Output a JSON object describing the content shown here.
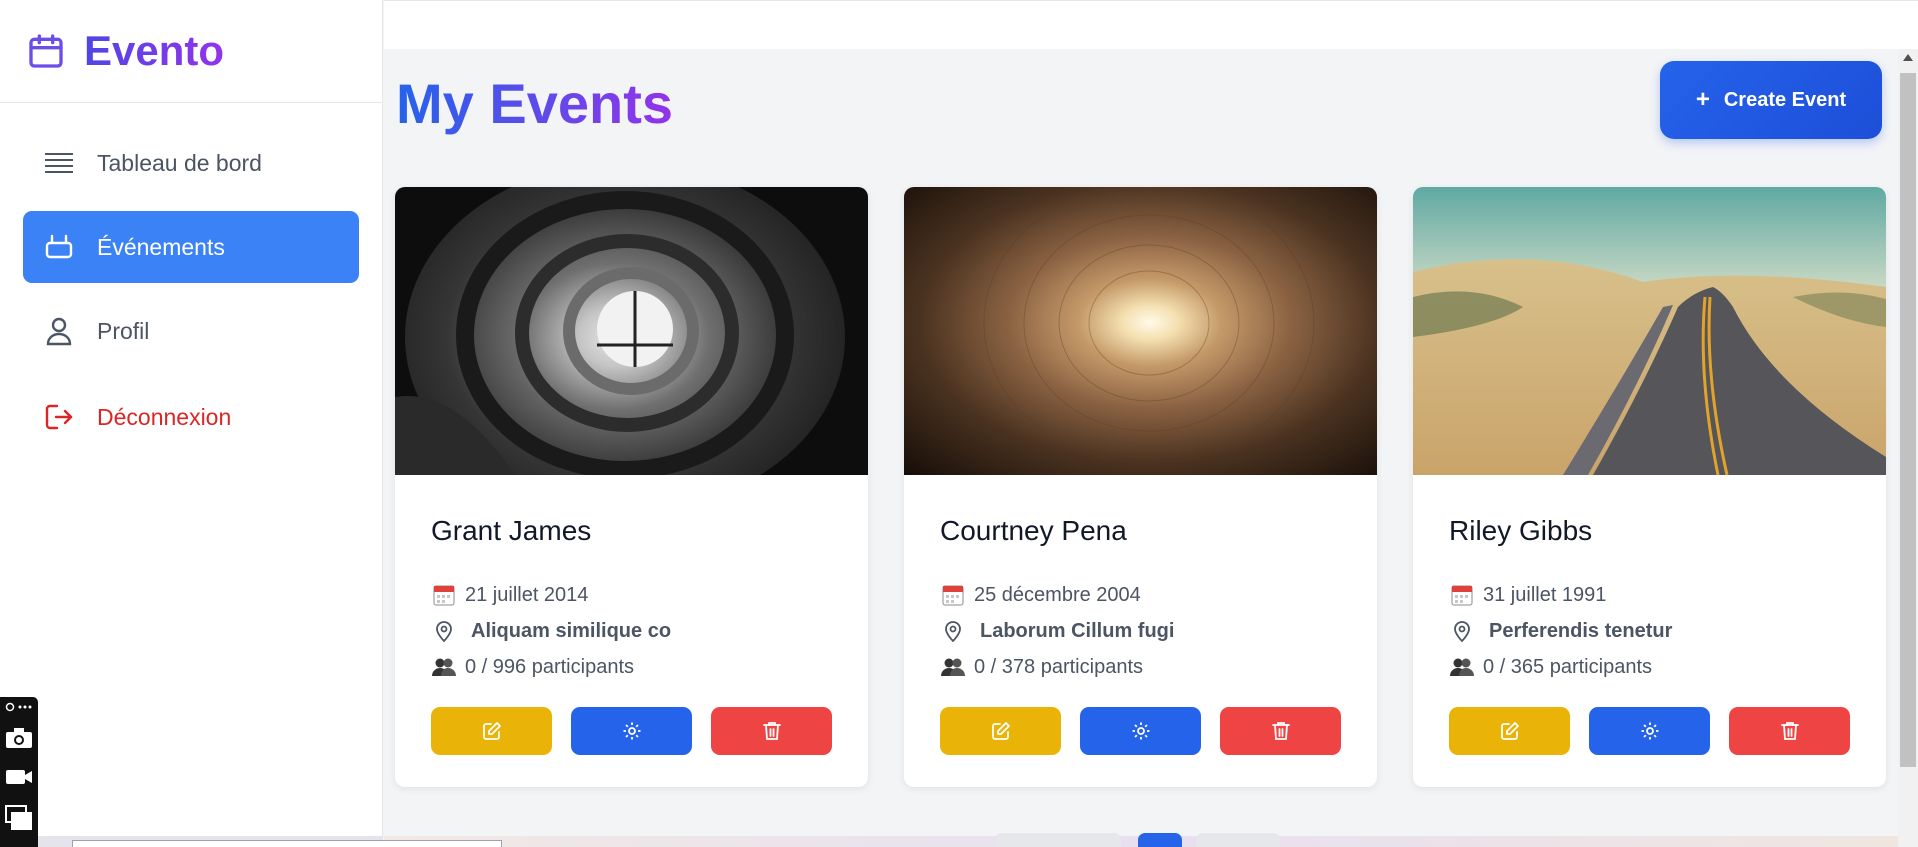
{
  "brand": {
    "name": "Evento",
    "icon": "calendar-icon",
    "color": "#6d4de8"
  },
  "sidebar": {
    "items": [
      {
        "label": "Tableau de bord",
        "icon": "menu-lines-icon",
        "active": false
      },
      {
        "label": "Événements",
        "icon": "event-icon",
        "active": true
      },
      {
        "label": "Profil",
        "icon": "user-icon",
        "active": false
      },
      {
        "label": "Déconnexion",
        "icon": "logout-icon",
        "active": false
      }
    ]
  },
  "main": {
    "title": "My Events",
    "create_button": {
      "icon": "+",
      "label": "Create Event"
    }
  },
  "events": [
    {
      "name": "Grant James",
      "date": "21 juillet 2014",
      "location": "Aliquam similique co",
      "participants": "0 / 996 participants",
      "image": "spiral-staircase"
    },
    {
      "name": "Courtney Pena",
      "date": "25 décembre 2004",
      "location": "Laborum Cillum fugi",
      "participants": "0 / 378 participants",
      "image": "tunnel-light"
    },
    {
      "name": "Riley Gibbs",
      "date": "31 juillet 1991",
      "location": "Perferendis tenetur",
      "participants": "0 / 365 participants",
      "image": "desert-road"
    }
  ],
  "colors": {
    "accent": "#3b82f6",
    "edit": "#eab308",
    "settings": "#2563eb",
    "delete": "#ef4444",
    "logout": "#dc2626"
  }
}
